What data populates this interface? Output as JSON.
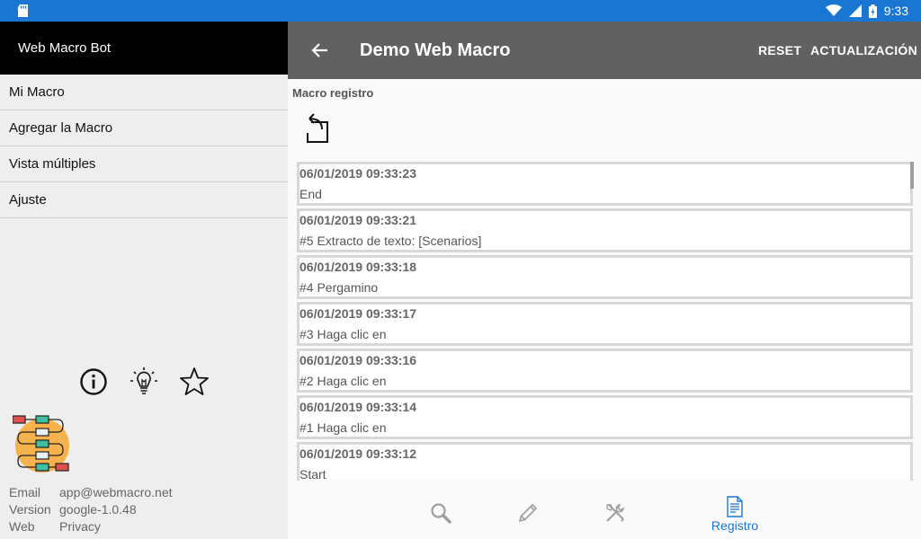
{
  "status_bar": {
    "time": "9:33"
  },
  "drawer": {
    "app_name": "Web Macro Bot",
    "menu": [
      "Mi Macro",
      "Agregar la Macro",
      "Vista múltiples",
      "Ajuste"
    ],
    "icons": [
      "info-icon",
      "lightbulb-icon",
      "star-icon"
    ],
    "info": {
      "email_label": "Email",
      "email": "app@webmacro.net",
      "version_label": "Version",
      "version": "google-1.0.48",
      "web_label": "Web",
      "web": "Privacy"
    }
  },
  "appbar": {
    "title": "Demo Web Macro",
    "reset": "RESET",
    "update": "ACTUALIZACIÓN"
  },
  "content": {
    "section_title": "Macro registro",
    "log": [
      {
        "time": "06/01/2019 09:33:23",
        "message": "End"
      },
      {
        "time": "06/01/2019 09:33:21",
        "message": "#5 Extracto de texto: [Scenarios]"
      },
      {
        "time": "06/01/2019 09:33:18",
        "message": "#4 Pergamino"
      },
      {
        "time": "06/01/2019 09:33:17",
        "message": "#3 Haga clic en"
      },
      {
        "time": "06/01/2019 09:33:16",
        "message": "#2 Haga clic en"
      },
      {
        "time": "06/01/2019 09:33:14",
        "message": "#1 Haga clic en"
      },
      {
        "time": "06/01/2019 09:33:12",
        "message": "Start"
      }
    ]
  },
  "bottom_nav": {
    "items": [
      {
        "icon": "search-icon"
      },
      {
        "icon": "pencil-icon"
      },
      {
        "icon": "tools-icon"
      },
      {
        "icon": "document-icon",
        "label": "Registro",
        "active": true
      }
    ]
  },
  "colors": {
    "status_bar": "#1976d2",
    "appbar": "#616161",
    "drawer_header": "#000000",
    "accent": "#1976d2"
  }
}
